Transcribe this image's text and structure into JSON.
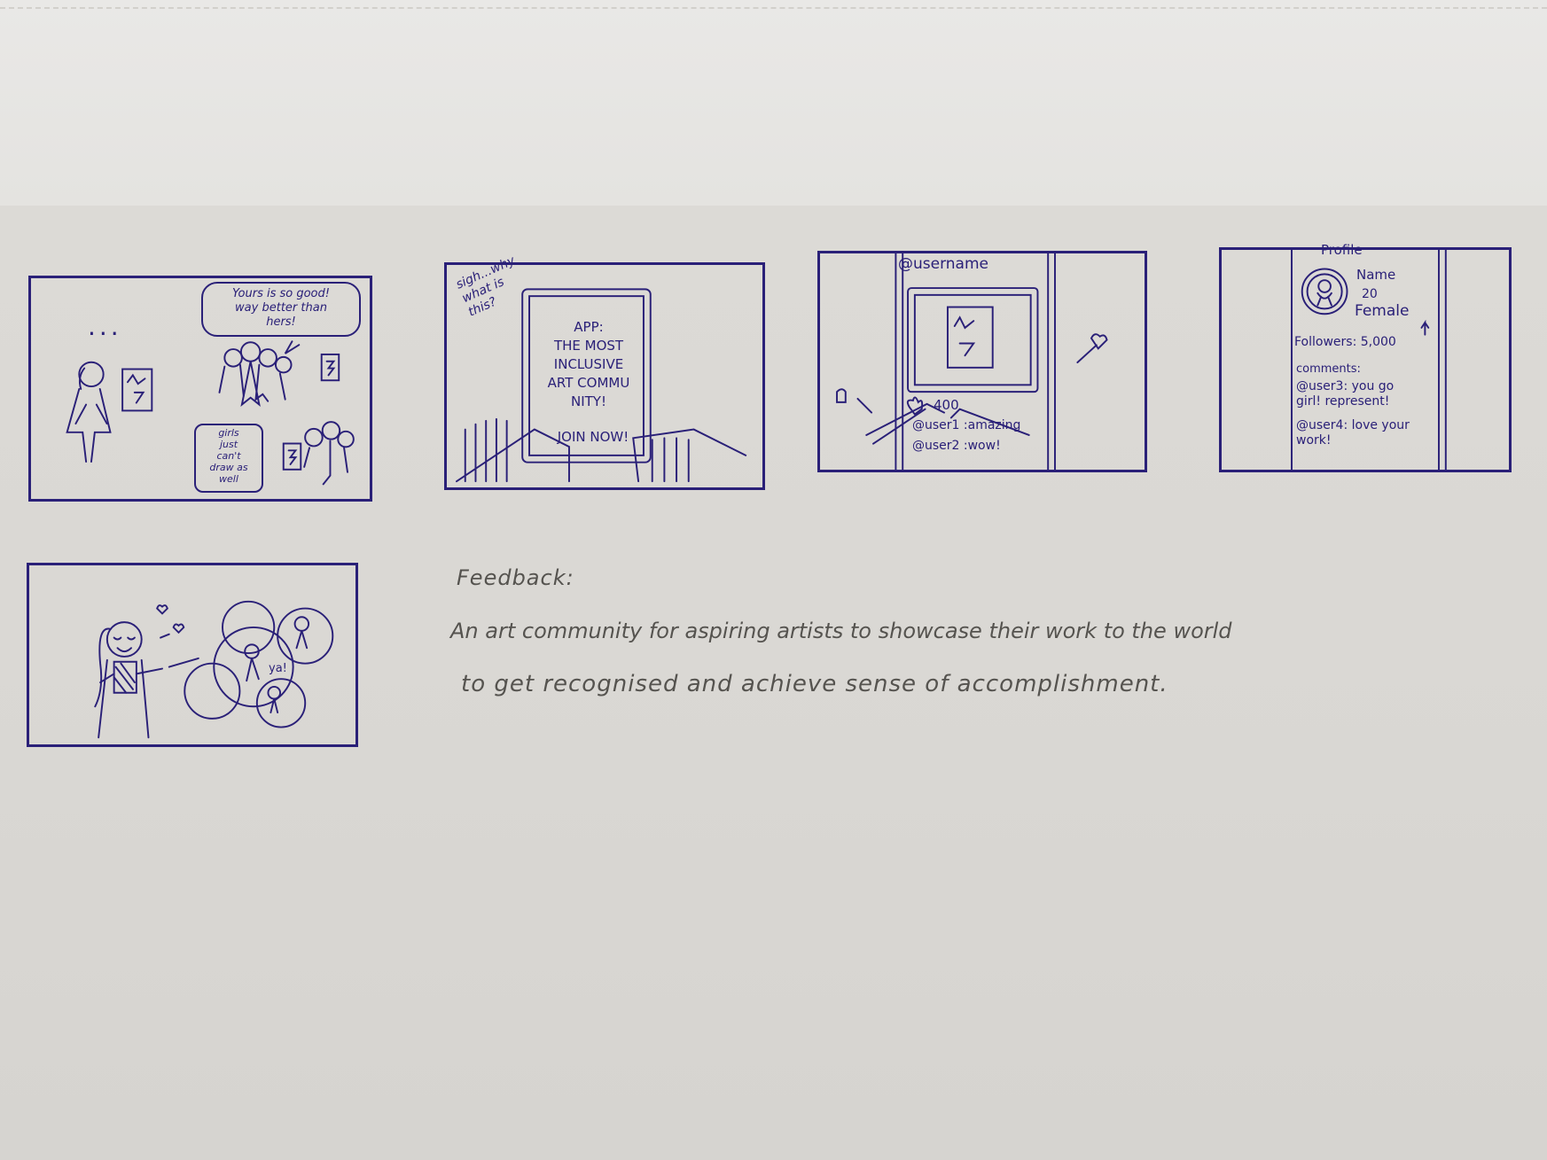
{
  "panel1": {
    "dots": "...",
    "bubble_top": "Yours is so good!\nway better than\nhers!",
    "bubble_bottom": "girls\njust\ncan't\ndraw as\nwell"
  },
  "panel2": {
    "side_note": "sigh...why\nwhat is\nthis?",
    "screen_text": "APP:\nTHE MOST\nINCLUSIVE\nART COMMU\nNITY!",
    "cta": "JOIN NOW!"
  },
  "panel3": {
    "username": "@username",
    "likes": "400",
    "comment1": "@user1 :amazing",
    "comment2": "@user2 :wow!"
  },
  "panel4": {
    "title": "Profile",
    "name": "Name",
    "age": "20",
    "gender": "Female",
    "followers": "Followers: 5,000",
    "comments_label": "comments:",
    "comment1": "@user3: you go\ngirl! represent!",
    "comment2": "@user4: love your\nwork!"
  },
  "panel5": {
    "shout": "ya!"
  },
  "feedback": {
    "heading": "Feedback:",
    "line1": "An art community for aspiring artists to showcase their work to the world",
    "line2": "to get recognised and achieve sense of accomplishment."
  },
  "colors": {
    "ink": "#2a2078",
    "pencil": "#55534f",
    "paper": "#dcdad6"
  }
}
